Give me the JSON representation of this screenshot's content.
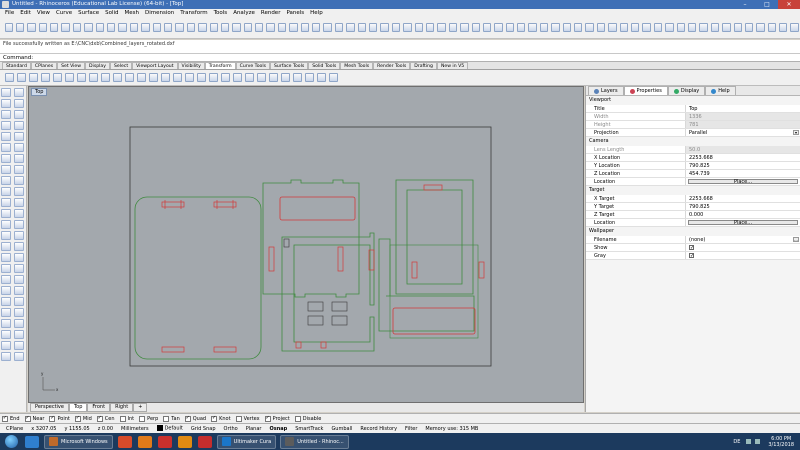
{
  "window": {
    "title": "Untitled - Rhinoceros (Educational Lab License) (64-bit) - [Top]",
    "controls": [
      "–",
      "□",
      "✕"
    ]
  },
  "menu": [
    "File",
    "Edit",
    "View",
    "Curve",
    "Surface",
    "Solid",
    "Mesh",
    "Dimension",
    "Transform",
    "Tools",
    "Analyze",
    "Render",
    "Panels",
    "Help"
  ],
  "command": {
    "history": "File successfully written as E:\\CNC\\dxb\\Combined_layers_rotated.dxf",
    "prompt": "Command:",
    "value": ""
  },
  "tabs": [
    "Standard",
    "CPlanes",
    "Set View",
    "Display",
    "Select",
    "Viewport Layout",
    "Visibility",
    "Transform",
    "Curve Tools",
    "Surface Tools",
    "Solid Tools",
    "Mesh Tools",
    "Render Tools",
    "Drafting",
    "New in V5"
  ],
  "active_tab": "Transform",
  "viewport": {
    "label": "Top",
    "axis_x": "x",
    "axis_y": "y",
    "tabs": [
      "Perspective",
      "Top",
      "Front",
      "Right",
      "+"
    ],
    "active_tab": "Top"
  },
  "snaps": [
    {
      "label": "End",
      "checked": true
    },
    {
      "label": "Near",
      "checked": true
    },
    {
      "label": "Point",
      "checked": true
    },
    {
      "label": "Mid",
      "checked": true
    },
    {
      "label": "Cen",
      "checked": true
    },
    {
      "label": "Int",
      "checked": false
    },
    {
      "label": "Perp",
      "checked": false
    },
    {
      "label": "Tan",
      "checked": false
    },
    {
      "label": "Quad",
      "checked": true
    },
    {
      "label": "Knot",
      "checked": true
    },
    {
      "label": "Vertex",
      "checked": false
    },
    {
      "label": "Project",
      "checked": true
    },
    {
      "label": "Disable",
      "checked": false
    }
  ],
  "status": {
    "cplane": "CPlane",
    "x": "x 3207.05",
    "y": "y 1155.05",
    "z": "z 0.00",
    "units": "Millimeters",
    "layer": "Default",
    "toggles": [
      "Grid Snap",
      "Ortho",
      "Planar",
      "Osnap",
      "SmartTrack",
      "Gumball",
      "Record History",
      "Filter"
    ],
    "bold_toggles": [
      "Osnap"
    ],
    "memory": "Memory use: 315 MB"
  },
  "panel": {
    "tabs": [
      "Layers",
      "Properties",
      "Display",
      "Help"
    ],
    "active_tab": "Properties",
    "sections": {
      "viewport": "Viewport",
      "camera": "Camera",
      "target": "Target",
      "wallpaper": "Wallpaper"
    },
    "viewport_rows": [
      {
        "key": "Title",
        "value": "Top",
        "dim": false
      },
      {
        "key": "Width",
        "value": "1336",
        "dim": true
      },
      {
        "key": "Height",
        "value": "781",
        "dim": true
      },
      {
        "key": "Projection",
        "value": "Parallel",
        "dim": false,
        "dropdown": true
      }
    ],
    "camera_rows": [
      {
        "key": "Lens Length",
        "value": "50.0",
        "dim": true
      },
      {
        "key": "X Location",
        "value": "2253.668",
        "dim": false
      },
      {
        "key": "Y Location",
        "value": "790.825",
        "dim": false
      },
      {
        "key": "Z Location",
        "value": "454.739",
        "dim": false
      },
      {
        "key": "Location",
        "value": "Place...",
        "dim": false,
        "button": true
      }
    ],
    "target_rows": [
      {
        "key": "X Target",
        "value": "2253.668",
        "dim": false
      },
      {
        "key": "Y Target",
        "value": "790.825",
        "dim": false
      },
      {
        "key": "Z Target",
        "value": "0.000",
        "dim": false
      },
      {
        "key": "Location",
        "value": "Place...",
        "dim": false,
        "button": true
      }
    ],
    "wallpaper_rows": [
      {
        "key": "Filename",
        "value": "(none)",
        "dim": false,
        "browse": true
      },
      {
        "key": "Show",
        "value": "✓",
        "dim": false,
        "check": true
      },
      {
        "key": "Gray",
        "value": "✓",
        "dim": false,
        "check": true
      }
    ]
  },
  "taskbar": {
    "buttons": [
      {
        "label": "Microsoft Windows",
        "color": "#c06a2b"
      },
      {
        "label": "Ultimaker Cura",
        "color": "#1b76c9"
      },
      {
        "label": "Untitled - Rhinoc...",
        "color": "#5c5c5c"
      }
    ],
    "language": "DE",
    "time": "6:00 PM",
    "date": "3/13/2018"
  },
  "colors": {
    "viewport_bg": "#a3a8ad",
    "curve_black": "#3a3a3a",
    "curve_green": "#3f8a3f",
    "curve_red": "#d23a3a",
    "title_bar": "#3e6fb6"
  }
}
